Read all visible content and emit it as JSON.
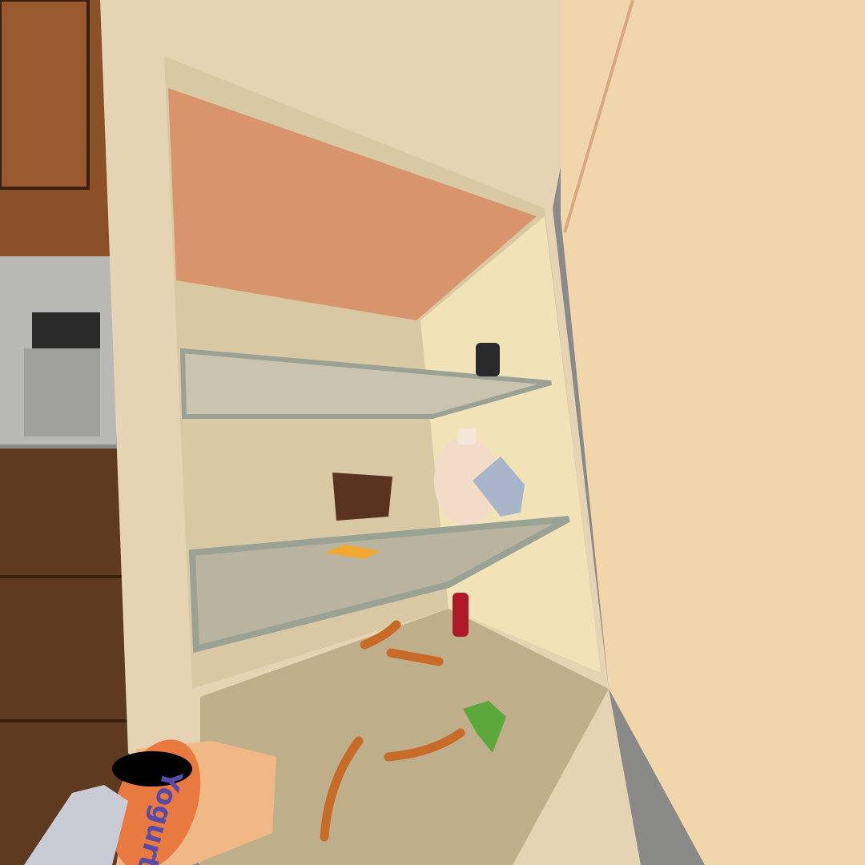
{
  "scene": {
    "type": "VR kitchen refrigerator interaction",
    "held_item_label": "Yogurt"
  },
  "colors": {
    "fridge_body": "#e8d8b8",
    "fridge_door": "#f0d8ac",
    "fridge_interior_top": "#d99a6e",
    "shelf": "#a8b0a0",
    "cabinet_wood": "#7a4a2a",
    "yogurt_cup": "#e87a40",
    "yogurt_text": "#5a4aa8",
    "hand": "#c8ccd4"
  }
}
